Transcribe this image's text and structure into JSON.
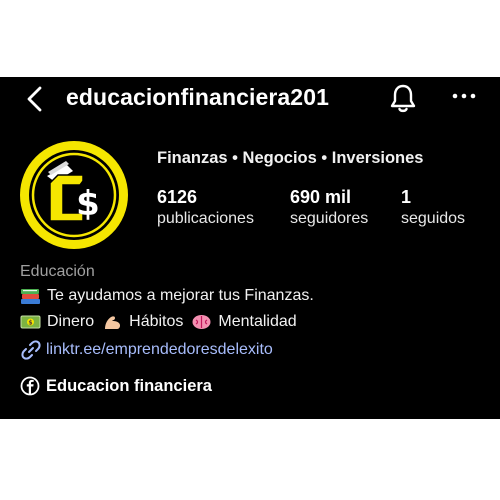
{
  "header": {
    "username": "educacionfinanciera201",
    "back_icon": "chevron-left-icon",
    "bell_icon": "bell-icon",
    "more_icon": "more-horizontal-icon"
  },
  "profile": {
    "tagline": "Finanzas • Negocios • Inversiones",
    "avatar_colors": {
      "background": "#f5e600",
      "ring": "#000000",
      "mark": "#f5e600"
    },
    "avatar_mark": "C$",
    "stats": [
      {
        "value": "6126",
        "label": "publicaciones"
      },
      {
        "value": "690 mil",
        "label": "seguidores"
      },
      {
        "value": "1",
        "label": "seguidos"
      }
    ]
  },
  "bio": {
    "category": "Educación",
    "line1": "Te ayudamos a mejorar tus Finanzas.",
    "line1_emoji": "books-emoji",
    "line2": {
      "items": [
        {
          "emoji": "money-emoji",
          "text": "Dinero"
        },
        {
          "emoji": "flexed-biceps-emoji",
          "text": "Hábitos"
        },
        {
          "emoji": "brain-emoji",
          "text": "Mentalidad"
        }
      ]
    },
    "link": "linktr.ee/emprendedoresdelexito",
    "link_color": "#a8bdfc",
    "facebook_page": "Educacion financiera"
  }
}
